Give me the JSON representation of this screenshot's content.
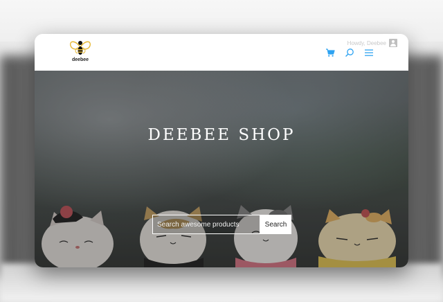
{
  "colors": {
    "accent": "#2ea3f2",
    "cart_icon": "#2ea3f2"
  },
  "header": {
    "logo_text": "deebee",
    "user_text": "Howdy, Deebee",
    "icons": [
      "cart-icon",
      "search-icon",
      "menu-icon"
    ]
  },
  "hero": {
    "title": "DEEBEE SHOP"
  },
  "search": {
    "placeholder": "Search awesome products",
    "button_label": "Search"
  }
}
